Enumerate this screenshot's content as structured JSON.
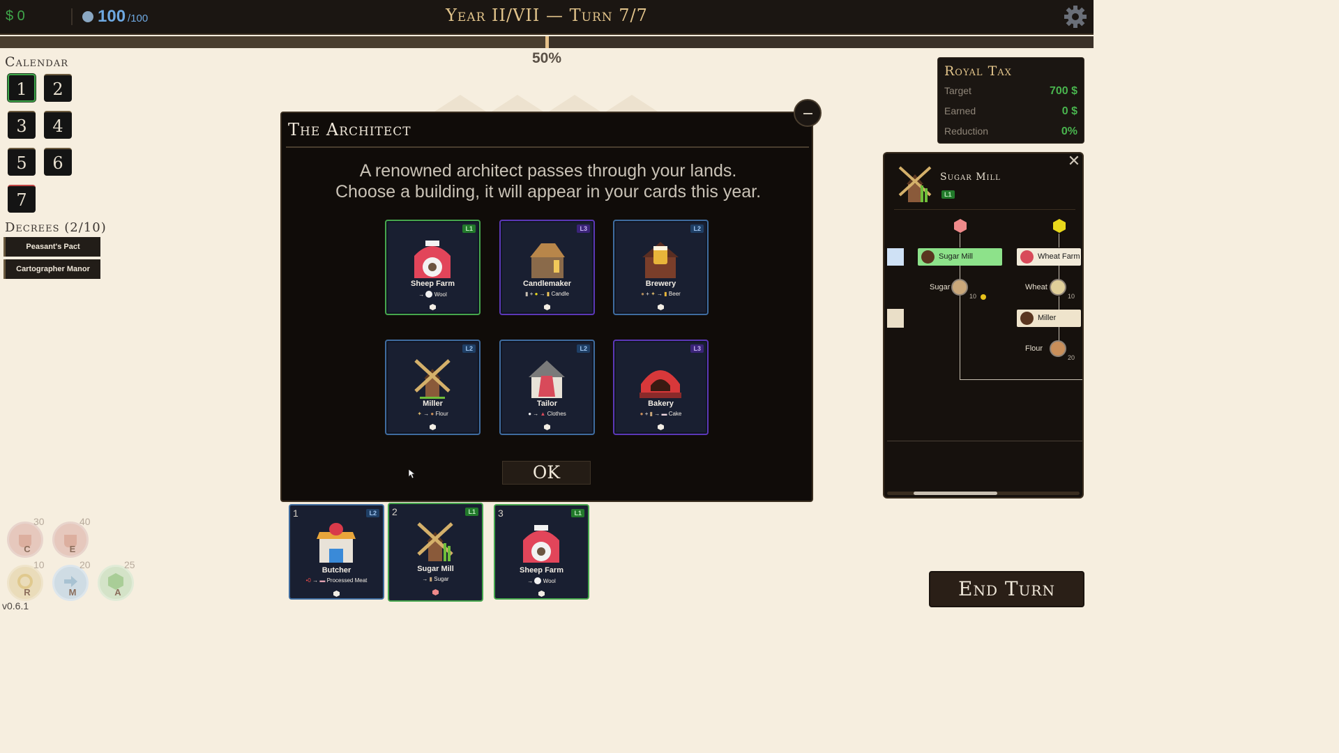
{
  "topbar": {
    "money": "$ 0",
    "energy_value": "100",
    "energy_max": "/100",
    "turn_title": "Year II/VII — Turn 7/7",
    "progress_label": "50%",
    "progress_fraction": 0.5
  },
  "calendar": {
    "title": "Calendar",
    "days": [
      "1",
      "2",
      "3",
      "4",
      "5",
      "6",
      "7"
    ]
  },
  "decrees": {
    "title": "Decrees (2/10)",
    "items": [
      "Peasant's Pact",
      "Cartographer Manor"
    ]
  },
  "abilities": [
    {
      "letter": "C",
      "cost": "30"
    },
    {
      "letter": "E",
      "cost": "40"
    },
    {
      "letter": "R",
      "cost": "10"
    },
    {
      "letter": "M",
      "cost": "20"
    },
    {
      "letter": "A",
      "cost": "25"
    }
  ],
  "version": "v0.6.1",
  "royal_tax": {
    "title": "Royal Tax",
    "rows": [
      {
        "label": "Target",
        "value": "700 $"
      },
      {
        "label": "Earned",
        "value": "0 $"
      },
      {
        "label": "Reduction",
        "value": "0%"
      }
    ]
  },
  "detail_panel": {
    "title": "Sugar Mill",
    "level": "L1",
    "nodes": {
      "sugar_mill": "Sugar Mill",
      "wheat_farm": "Wheat Farm",
      "miller": "Miller"
    },
    "resources": {
      "sugar": {
        "label": "Sugar",
        "amount": "10"
      },
      "wheat": {
        "label": "Wheat",
        "amount": "10"
      },
      "flour": {
        "label": "Flour",
        "amount": "20"
      }
    }
  },
  "modal": {
    "title": "The Architect",
    "line1": "A renowned architect passes through your lands.",
    "line2": "Choose a building, it will appear in your cards this year.",
    "ok_label": "OK",
    "buildings": [
      {
        "name": "Sheep Farm",
        "level": "L1",
        "output": "Wool"
      },
      {
        "name": "Candlemaker",
        "level": "L3",
        "output": "Candle"
      },
      {
        "name": "Brewery",
        "level": "L2",
        "output": "Beer"
      },
      {
        "name": "Miller",
        "level": "L2",
        "output": "Flour"
      },
      {
        "name": "Tailor",
        "level": "L2",
        "output": "Clothes"
      },
      {
        "name": "Bakery",
        "level": "L3",
        "output": "Cake"
      }
    ]
  },
  "hand": [
    {
      "num": "1",
      "name": "Butcher",
      "level": "L2",
      "output": "Processed Meat",
      "cost": "0"
    },
    {
      "num": "2",
      "name": "Sugar Mill",
      "level": "L1",
      "output": "Sugar"
    },
    {
      "num": "3",
      "name": "Sheep Farm",
      "level": "L1",
      "output": "Wool"
    }
  ],
  "end_turn_label": "End Turn",
  "colors": {
    "gold": "#e2c48b",
    "green": "#3fa64a",
    "energy_blue": "#6ea8e0",
    "level1": "#46a64d",
    "level2": "#3f6c9f",
    "level3": "#5b38b7"
  }
}
